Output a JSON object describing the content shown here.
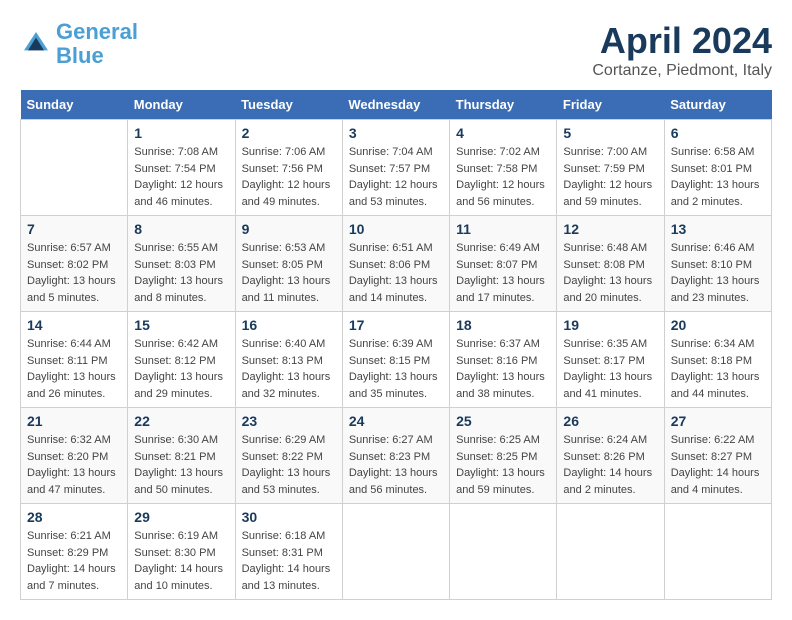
{
  "header": {
    "logo_line1": "General",
    "logo_line2": "Blue",
    "month_title": "April 2024",
    "location": "Cortanze, Piedmont, Italy"
  },
  "weekdays": [
    "Sunday",
    "Monday",
    "Tuesday",
    "Wednesday",
    "Thursday",
    "Friday",
    "Saturday"
  ],
  "weeks": [
    [
      {
        "day": "",
        "info": ""
      },
      {
        "day": "1",
        "info": "Sunrise: 7:08 AM\nSunset: 7:54 PM\nDaylight: 12 hours\nand 46 minutes."
      },
      {
        "day": "2",
        "info": "Sunrise: 7:06 AM\nSunset: 7:56 PM\nDaylight: 12 hours\nand 49 minutes."
      },
      {
        "day": "3",
        "info": "Sunrise: 7:04 AM\nSunset: 7:57 PM\nDaylight: 12 hours\nand 53 minutes."
      },
      {
        "day": "4",
        "info": "Sunrise: 7:02 AM\nSunset: 7:58 PM\nDaylight: 12 hours\nand 56 minutes."
      },
      {
        "day": "5",
        "info": "Sunrise: 7:00 AM\nSunset: 7:59 PM\nDaylight: 12 hours\nand 59 minutes."
      },
      {
        "day": "6",
        "info": "Sunrise: 6:58 AM\nSunset: 8:01 PM\nDaylight: 13 hours\nand 2 minutes."
      }
    ],
    [
      {
        "day": "7",
        "info": "Sunrise: 6:57 AM\nSunset: 8:02 PM\nDaylight: 13 hours\nand 5 minutes."
      },
      {
        "day": "8",
        "info": "Sunrise: 6:55 AM\nSunset: 8:03 PM\nDaylight: 13 hours\nand 8 minutes."
      },
      {
        "day": "9",
        "info": "Sunrise: 6:53 AM\nSunset: 8:05 PM\nDaylight: 13 hours\nand 11 minutes."
      },
      {
        "day": "10",
        "info": "Sunrise: 6:51 AM\nSunset: 8:06 PM\nDaylight: 13 hours\nand 14 minutes."
      },
      {
        "day": "11",
        "info": "Sunrise: 6:49 AM\nSunset: 8:07 PM\nDaylight: 13 hours\nand 17 minutes."
      },
      {
        "day": "12",
        "info": "Sunrise: 6:48 AM\nSunset: 8:08 PM\nDaylight: 13 hours\nand 20 minutes."
      },
      {
        "day": "13",
        "info": "Sunrise: 6:46 AM\nSunset: 8:10 PM\nDaylight: 13 hours\nand 23 minutes."
      }
    ],
    [
      {
        "day": "14",
        "info": "Sunrise: 6:44 AM\nSunset: 8:11 PM\nDaylight: 13 hours\nand 26 minutes."
      },
      {
        "day": "15",
        "info": "Sunrise: 6:42 AM\nSunset: 8:12 PM\nDaylight: 13 hours\nand 29 minutes."
      },
      {
        "day": "16",
        "info": "Sunrise: 6:40 AM\nSunset: 8:13 PM\nDaylight: 13 hours\nand 32 minutes."
      },
      {
        "day": "17",
        "info": "Sunrise: 6:39 AM\nSunset: 8:15 PM\nDaylight: 13 hours\nand 35 minutes."
      },
      {
        "day": "18",
        "info": "Sunrise: 6:37 AM\nSunset: 8:16 PM\nDaylight: 13 hours\nand 38 minutes."
      },
      {
        "day": "19",
        "info": "Sunrise: 6:35 AM\nSunset: 8:17 PM\nDaylight: 13 hours\nand 41 minutes."
      },
      {
        "day": "20",
        "info": "Sunrise: 6:34 AM\nSunset: 8:18 PM\nDaylight: 13 hours\nand 44 minutes."
      }
    ],
    [
      {
        "day": "21",
        "info": "Sunrise: 6:32 AM\nSunset: 8:20 PM\nDaylight: 13 hours\nand 47 minutes."
      },
      {
        "day": "22",
        "info": "Sunrise: 6:30 AM\nSunset: 8:21 PM\nDaylight: 13 hours\nand 50 minutes."
      },
      {
        "day": "23",
        "info": "Sunrise: 6:29 AM\nSunset: 8:22 PM\nDaylight: 13 hours\nand 53 minutes."
      },
      {
        "day": "24",
        "info": "Sunrise: 6:27 AM\nSunset: 8:23 PM\nDaylight: 13 hours\nand 56 minutes."
      },
      {
        "day": "25",
        "info": "Sunrise: 6:25 AM\nSunset: 8:25 PM\nDaylight: 13 hours\nand 59 minutes."
      },
      {
        "day": "26",
        "info": "Sunrise: 6:24 AM\nSunset: 8:26 PM\nDaylight: 14 hours\nand 2 minutes."
      },
      {
        "day": "27",
        "info": "Sunrise: 6:22 AM\nSunset: 8:27 PM\nDaylight: 14 hours\nand 4 minutes."
      }
    ],
    [
      {
        "day": "28",
        "info": "Sunrise: 6:21 AM\nSunset: 8:29 PM\nDaylight: 14 hours\nand 7 minutes."
      },
      {
        "day": "29",
        "info": "Sunrise: 6:19 AM\nSunset: 8:30 PM\nDaylight: 14 hours\nand 10 minutes."
      },
      {
        "day": "30",
        "info": "Sunrise: 6:18 AM\nSunset: 8:31 PM\nDaylight: 14 hours\nand 13 minutes."
      },
      {
        "day": "",
        "info": ""
      },
      {
        "day": "",
        "info": ""
      },
      {
        "day": "",
        "info": ""
      },
      {
        "day": "",
        "info": ""
      }
    ]
  ]
}
